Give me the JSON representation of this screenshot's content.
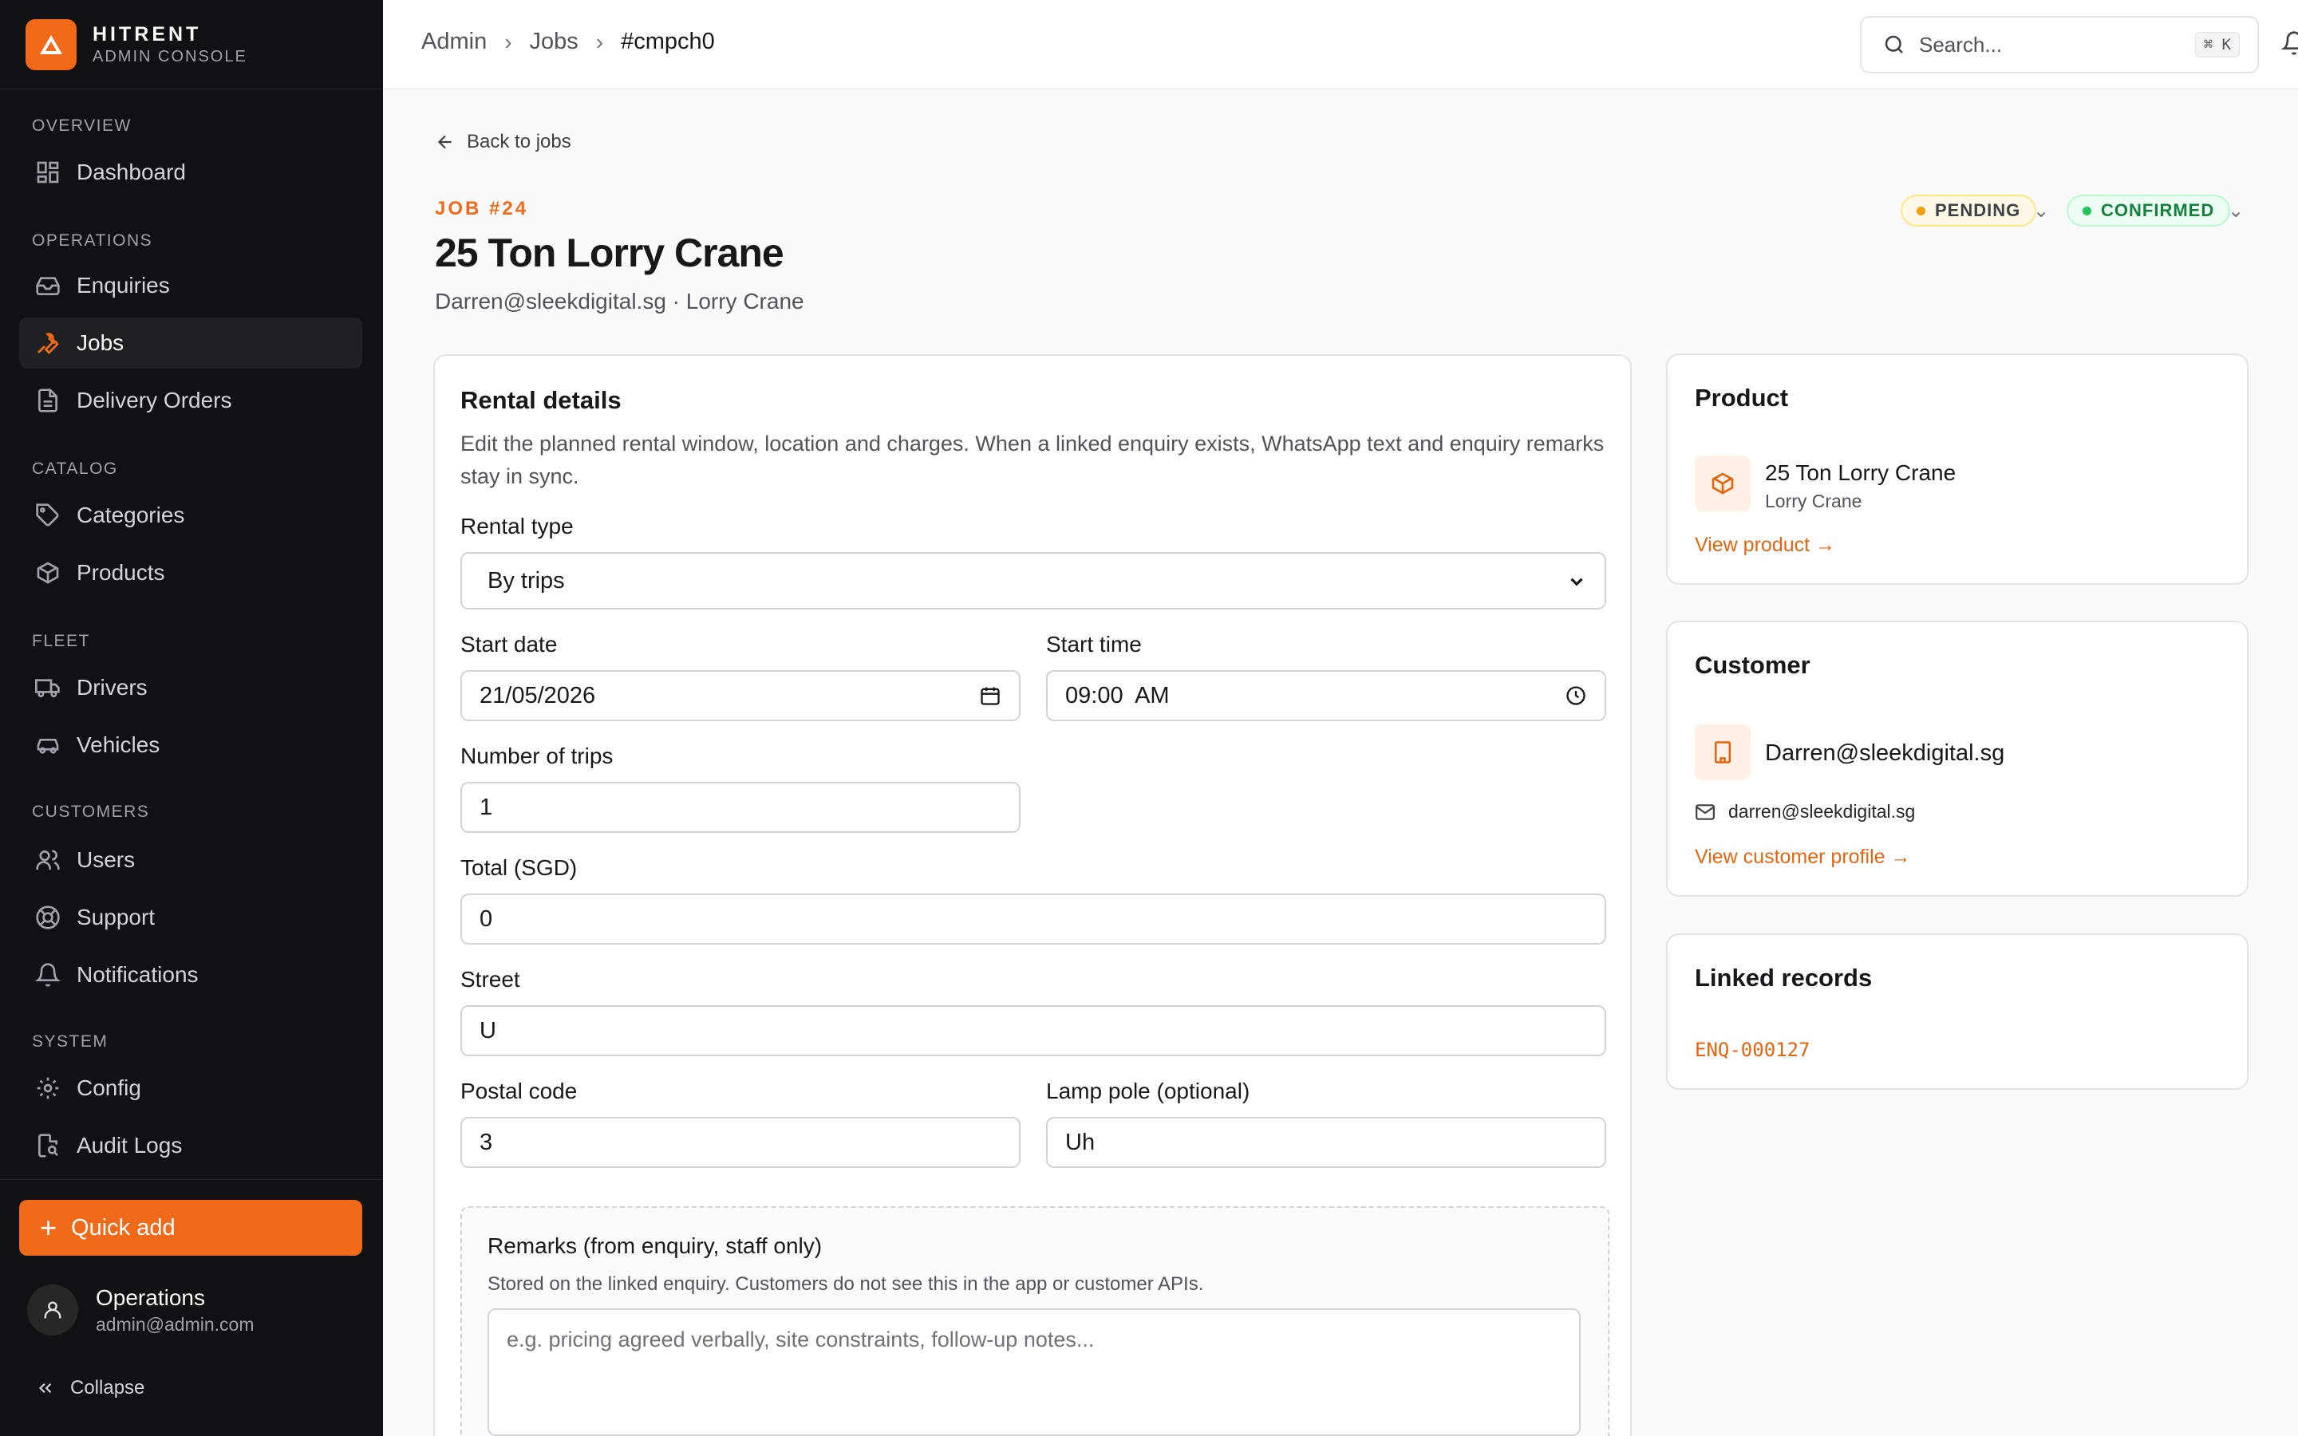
{
  "brand": {
    "name": "HITRENT",
    "subtitle": "ADMIN CONSOLE"
  },
  "sidebar": {
    "sections": {
      "overview": "OVERVIEW",
      "operations": "OPERATIONS",
      "catalog": "CATALOG",
      "fleet": "FLEET",
      "customers": "CUSTOMERS",
      "system": "SYSTEM"
    },
    "items": {
      "dashboard": "Dashboard",
      "enquiries": "Enquiries",
      "jobs": "Jobs",
      "delivery_orders": "Delivery Orders",
      "categories": "Categories",
      "products": "Products",
      "drivers": "Drivers",
      "vehicles": "Vehicles",
      "users": "Users",
      "support": "Support",
      "notifications": "Notifications",
      "config": "Config",
      "audit_logs": "Audit Logs"
    },
    "active_item": "Jobs",
    "quick_add": "Quick add",
    "user": {
      "name": "Operations",
      "email": "admin@admin.com"
    },
    "collapse": "Collapse"
  },
  "topbar": {
    "breadcrumb": [
      "Admin",
      "Jobs",
      "#cmpch0"
    ],
    "search_placeholder": "Search...",
    "shortcut": "⌘ K"
  },
  "job": {
    "back_link": "Back to jobs",
    "number": "JOB #24",
    "title": "25 Ton Lorry Crane",
    "subtitle": "Darren@sleekdigital.sg · Lorry Crane",
    "status_pending": "PENDING",
    "status_confirmed": "CONFIRMED",
    "colors": {
      "accent": "#f06a1a",
      "pending": "#f59e0b",
      "confirmed": "#22c55e"
    }
  },
  "rental": {
    "title": "Rental details",
    "description": "Edit the planned rental window, location and charges. When a linked enquiry exists, WhatsApp text and enquiry remarks stay in sync.",
    "rental_type_label": "Rental type",
    "rental_type_value": "By trips",
    "start_date_label": "Start date",
    "start_date_value": "21/05/2026",
    "start_time_label": "Start time",
    "start_time_value": "09:00  AM",
    "trips_label": "Number of trips",
    "trips_value": "1",
    "total_label": "Total (SGD)",
    "total_value": "0",
    "street_label": "Street",
    "street_value": "U",
    "postal_label": "Postal code",
    "postal_value": "3",
    "lamp_label": "Lamp pole (optional)",
    "lamp_value": "Uh",
    "remarks_title": "Remarks (from enquiry, staff only)",
    "remarks_help": "Stored on the linked enquiry. Customers do not see this in the app or customer APIs.",
    "remarks_placeholder": "e.g. pricing agreed verbally, site constraints, follow-up notes..."
  },
  "product_card": {
    "title": "Product",
    "name": "25 Ton Lorry Crane",
    "category": "Lorry Crane",
    "link": "View product →"
  },
  "customer_card": {
    "title": "Customer",
    "name": "Darren@sleekdigital.sg",
    "email": "darren@sleekdigital.sg",
    "link": "View customer profile →"
  },
  "linked_card": {
    "title": "Linked records",
    "record": "ENQ-000127"
  }
}
